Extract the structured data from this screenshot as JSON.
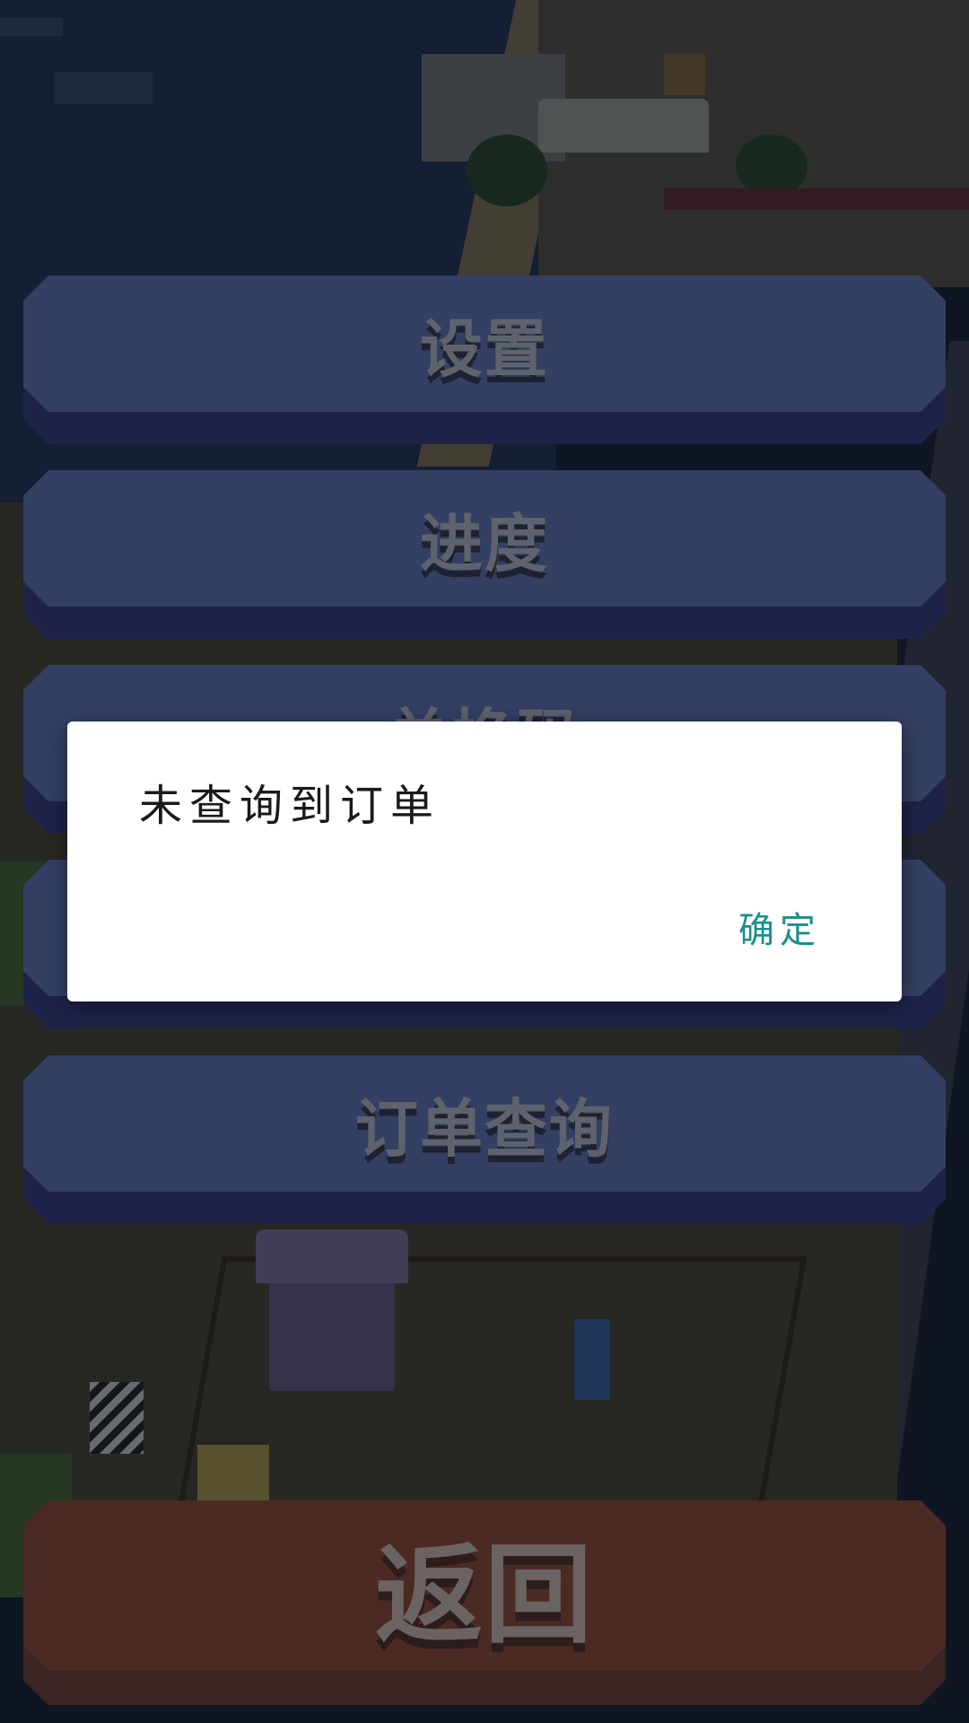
{
  "menu": {
    "settings_label": "设置",
    "progress_label": "进度",
    "redeem_label": "兑换码",
    "fourth_label": "",
    "order_query_label": "订单查询"
  },
  "back": {
    "label": "返回"
  },
  "dialog": {
    "message": "未查询到订单",
    "confirm_label": "确定"
  },
  "colors": {
    "button_face": "#333f63",
    "button_shadow": "#1f2248",
    "back_button_face": "#4c2a24",
    "confirm_text": "#1a8f8a",
    "overlay": "rgba(8,12,22,0.55)"
  },
  "icons": []
}
